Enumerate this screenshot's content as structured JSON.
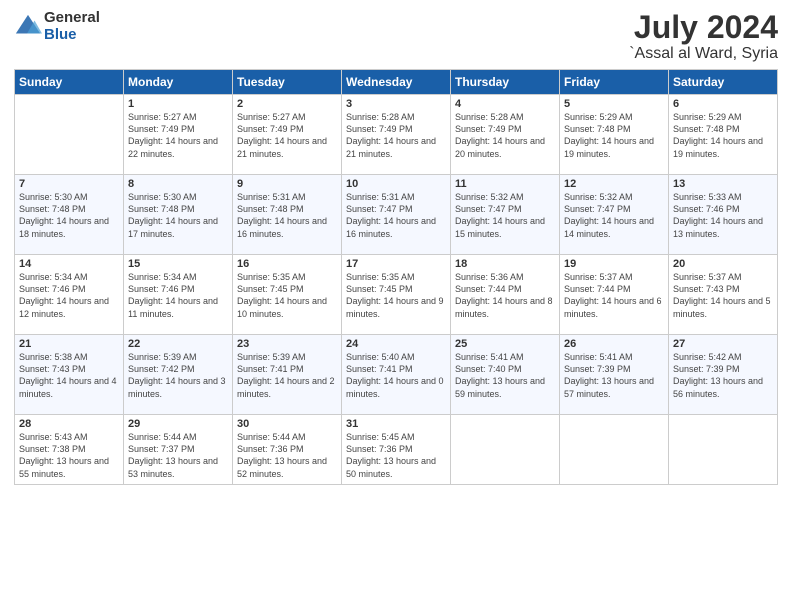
{
  "logo": {
    "general": "General",
    "blue": "Blue"
  },
  "title": "July 2024",
  "subtitle": "`Assal al Ward, Syria",
  "days": [
    "Sunday",
    "Monday",
    "Tuesday",
    "Wednesday",
    "Thursday",
    "Friday",
    "Saturday"
  ],
  "weeks": [
    [
      {
        "day": "",
        "sunrise": "",
        "sunset": "",
        "daylight": ""
      },
      {
        "day": "1",
        "sunrise": "Sunrise: 5:27 AM",
        "sunset": "Sunset: 7:49 PM",
        "daylight": "Daylight: 14 hours and 22 minutes."
      },
      {
        "day": "2",
        "sunrise": "Sunrise: 5:27 AM",
        "sunset": "Sunset: 7:49 PM",
        "daylight": "Daylight: 14 hours and 21 minutes."
      },
      {
        "day": "3",
        "sunrise": "Sunrise: 5:28 AM",
        "sunset": "Sunset: 7:49 PM",
        "daylight": "Daylight: 14 hours and 21 minutes."
      },
      {
        "day": "4",
        "sunrise": "Sunrise: 5:28 AM",
        "sunset": "Sunset: 7:49 PM",
        "daylight": "Daylight: 14 hours and 20 minutes."
      },
      {
        "day": "5",
        "sunrise": "Sunrise: 5:29 AM",
        "sunset": "Sunset: 7:48 PM",
        "daylight": "Daylight: 14 hours and 19 minutes."
      },
      {
        "day": "6",
        "sunrise": "Sunrise: 5:29 AM",
        "sunset": "Sunset: 7:48 PM",
        "daylight": "Daylight: 14 hours and 19 minutes."
      }
    ],
    [
      {
        "day": "7",
        "sunrise": "Sunrise: 5:30 AM",
        "sunset": "Sunset: 7:48 PM",
        "daylight": "Daylight: 14 hours and 18 minutes."
      },
      {
        "day": "8",
        "sunrise": "Sunrise: 5:30 AM",
        "sunset": "Sunset: 7:48 PM",
        "daylight": "Daylight: 14 hours and 17 minutes."
      },
      {
        "day": "9",
        "sunrise": "Sunrise: 5:31 AM",
        "sunset": "Sunset: 7:48 PM",
        "daylight": "Daylight: 14 hours and 16 minutes."
      },
      {
        "day": "10",
        "sunrise": "Sunrise: 5:31 AM",
        "sunset": "Sunset: 7:47 PM",
        "daylight": "Daylight: 14 hours and 16 minutes."
      },
      {
        "day": "11",
        "sunrise": "Sunrise: 5:32 AM",
        "sunset": "Sunset: 7:47 PM",
        "daylight": "Daylight: 14 hours and 15 minutes."
      },
      {
        "day": "12",
        "sunrise": "Sunrise: 5:32 AM",
        "sunset": "Sunset: 7:47 PM",
        "daylight": "Daylight: 14 hours and 14 minutes."
      },
      {
        "day": "13",
        "sunrise": "Sunrise: 5:33 AM",
        "sunset": "Sunset: 7:46 PM",
        "daylight": "Daylight: 14 hours and 13 minutes."
      }
    ],
    [
      {
        "day": "14",
        "sunrise": "Sunrise: 5:34 AM",
        "sunset": "Sunset: 7:46 PM",
        "daylight": "Daylight: 14 hours and 12 minutes."
      },
      {
        "day": "15",
        "sunrise": "Sunrise: 5:34 AM",
        "sunset": "Sunset: 7:46 PM",
        "daylight": "Daylight: 14 hours and 11 minutes."
      },
      {
        "day": "16",
        "sunrise": "Sunrise: 5:35 AM",
        "sunset": "Sunset: 7:45 PM",
        "daylight": "Daylight: 14 hours and 10 minutes."
      },
      {
        "day": "17",
        "sunrise": "Sunrise: 5:35 AM",
        "sunset": "Sunset: 7:45 PM",
        "daylight": "Daylight: 14 hours and 9 minutes."
      },
      {
        "day": "18",
        "sunrise": "Sunrise: 5:36 AM",
        "sunset": "Sunset: 7:44 PM",
        "daylight": "Daylight: 14 hours and 8 minutes."
      },
      {
        "day": "19",
        "sunrise": "Sunrise: 5:37 AM",
        "sunset": "Sunset: 7:44 PM",
        "daylight": "Daylight: 14 hours and 6 minutes."
      },
      {
        "day": "20",
        "sunrise": "Sunrise: 5:37 AM",
        "sunset": "Sunset: 7:43 PM",
        "daylight": "Daylight: 14 hours and 5 minutes."
      }
    ],
    [
      {
        "day": "21",
        "sunrise": "Sunrise: 5:38 AM",
        "sunset": "Sunset: 7:43 PM",
        "daylight": "Daylight: 14 hours and 4 minutes."
      },
      {
        "day": "22",
        "sunrise": "Sunrise: 5:39 AM",
        "sunset": "Sunset: 7:42 PM",
        "daylight": "Daylight: 14 hours and 3 minutes."
      },
      {
        "day": "23",
        "sunrise": "Sunrise: 5:39 AM",
        "sunset": "Sunset: 7:41 PM",
        "daylight": "Daylight: 14 hours and 2 minutes."
      },
      {
        "day": "24",
        "sunrise": "Sunrise: 5:40 AM",
        "sunset": "Sunset: 7:41 PM",
        "daylight": "Daylight: 14 hours and 0 minutes."
      },
      {
        "day": "25",
        "sunrise": "Sunrise: 5:41 AM",
        "sunset": "Sunset: 7:40 PM",
        "daylight": "Daylight: 13 hours and 59 minutes."
      },
      {
        "day": "26",
        "sunrise": "Sunrise: 5:41 AM",
        "sunset": "Sunset: 7:39 PM",
        "daylight": "Daylight: 13 hours and 57 minutes."
      },
      {
        "day": "27",
        "sunrise": "Sunrise: 5:42 AM",
        "sunset": "Sunset: 7:39 PM",
        "daylight": "Daylight: 13 hours and 56 minutes."
      }
    ],
    [
      {
        "day": "28",
        "sunrise": "Sunrise: 5:43 AM",
        "sunset": "Sunset: 7:38 PM",
        "daylight": "Daylight: 13 hours and 55 minutes."
      },
      {
        "day": "29",
        "sunrise": "Sunrise: 5:44 AM",
        "sunset": "Sunset: 7:37 PM",
        "daylight": "Daylight: 13 hours and 53 minutes."
      },
      {
        "day": "30",
        "sunrise": "Sunrise: 5:44 AM",
        "sunset": "Sunset: 7:36 PM",
        "daylight": "Daylight: 13 hours and 52 minutes."
      },
      {
        "day": "31",
        "sunrise": "Sunrise: 5:45 AM",
        "sunset": "Sunset: 7:36 PM",
        "daylight": "Daylight: 13 hours and 50 minutes."
      },
      {
        "day": "",
        "sunrise": "",
        "sunset": "",
        "daylight": ""
      },
      {
        "day": "",
        "sunrise": "",
        "sunset": "",
        "daylight": ""
      },
      {
        "day": "",
        "sunrise": "",
        "sunset": "",
        "daylight": ""
      }
    ]
  ]
}
